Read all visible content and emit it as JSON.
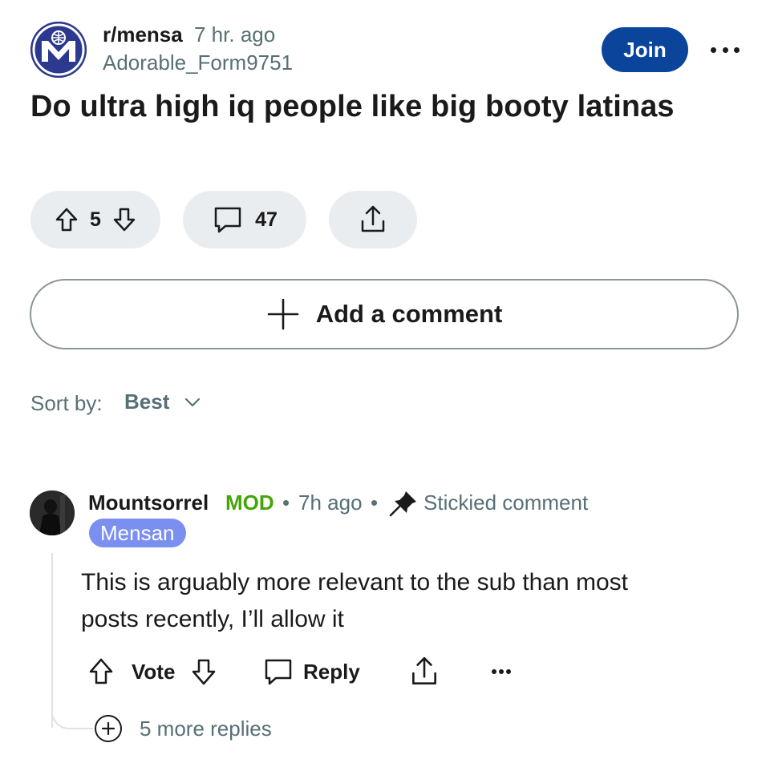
{
  "post": {
    "subreddit": "r/mensa",
    "time": "7 hr. ago",
    "author": "Adorable_Form9751",
    "join_label": "Join",
    "title": "Do ultra high iq people like big booty latinas",
    "score": "5",
    "comment_count": "47"
  },
  "add_comment": {
    "label": "Add a comment"
  },
  "sort": {
    "label": "Sort by:",
    "value": "Best"
  },
  "comment": {
    "author": "Mountsorrel",
    "badge": "MOD",
    "separator": "•",
    "time": "7h ago",
    "stickied": "Stickied comment",
    "flair": "Mensan",
    "body": "This is arguably more relevant to the sub than most posts recently, I’ll allow it",
    "vote_label": "Vote",
    "reply_label": "Reply",
    "more_replies": "5 more replies"
  },
  "colors": {
    "join_bg": "#0a449b",
    "mod_green": "#46a508",
    "flair_bg": "#7b8ff0",
    "meta_gray": "#576f76",
    "pill_bg": "#eaedef"
  },
  "icons": [
    "mensa-logo-icon",
    "more-horizontal-icon",
    "upvote-icon",
    "downvote-icon",
    "comment-icon",
    "share-icon",
    "plus-icon",
    "chevron-down-icon",
    "pin-icon",
    "reply-icon",
    "plus-circle-icon"
  ]
}
